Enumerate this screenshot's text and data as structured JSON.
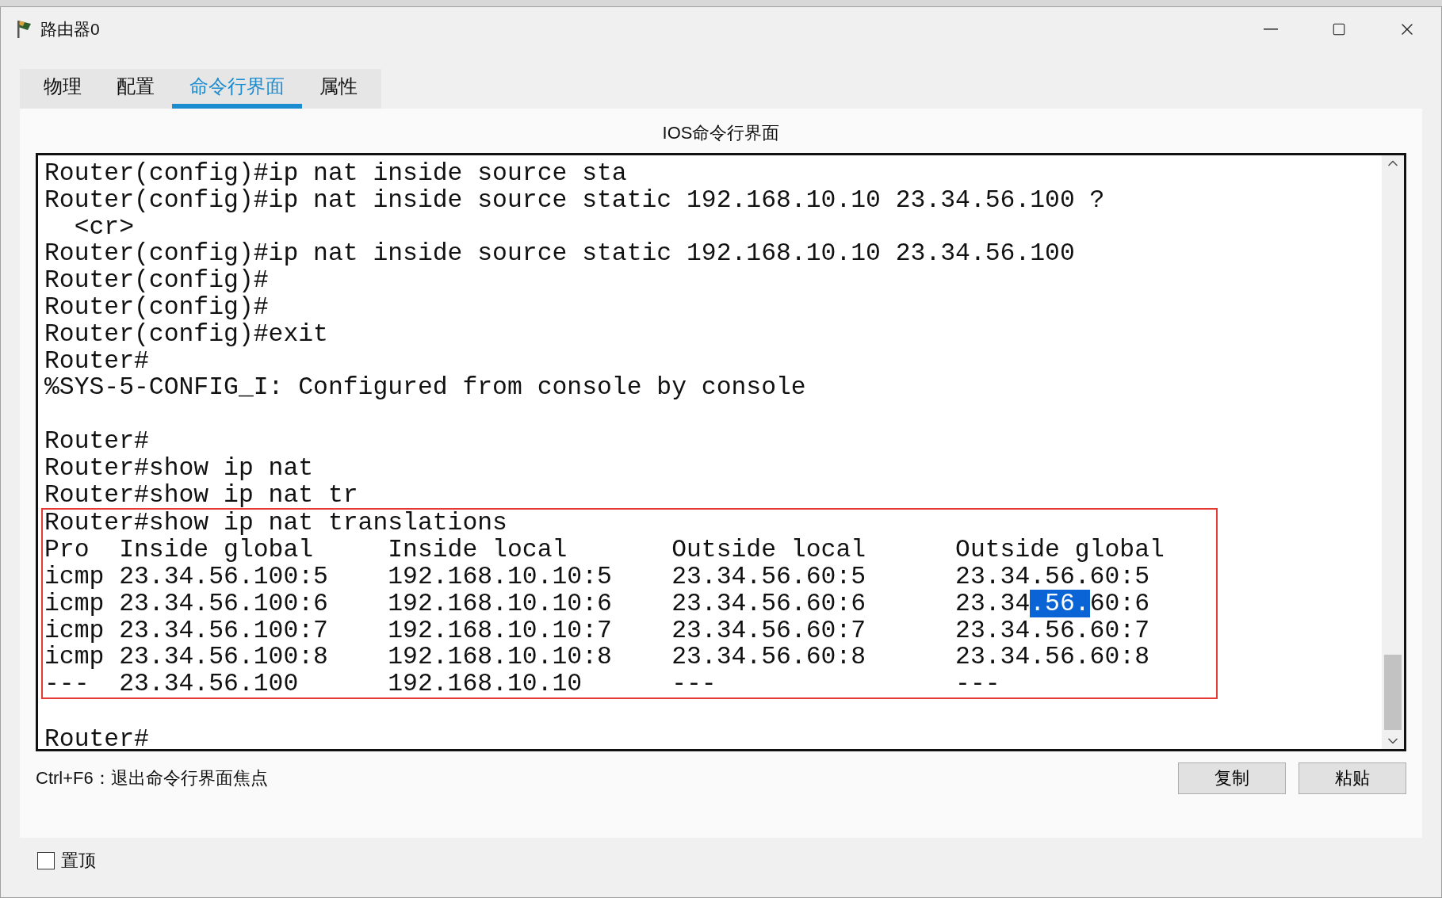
{
  "window": {
    "title": "路由器0"
  },
  "tabs": [
    {
      "label": "物理",
      "selected": false
    },
    {
      "label": "配置",
      "selected": false
    },
    {
      "label": "命令行界面",
      "selected": true
    },
    {
      "label": "属性",
      "selected": false
    }
  ],
  "panel_title": "IOS命令行界面",
  "terminal": {
    "lines_before": [
      {
        "kind": "text",
        "text": "Router(config)#ip nat inside source sta"
      },
      {
        "kind": "text",
        "text": "Router(config)#ip nat inside source static 192.168.10.10 23.34.56.100 ?"
      },
      {
        "kind": "text",
        "text": "  <cr>"
      },
      {
        "kind": "text",
        "text": "Router(config)#ip nat inside source static 192.168.10.10 23.34.56.100"
      },
      {
        "kind": "text",
        "text": "Router(config)#"
      },
      {
        "kind": "text",
        "text": "Router(config)#"
      },
      {
        "kind": "text",
        "text": "Router(config)#exit"
      },
      {
        "kind": "text",
        "text": "Router#"
      },
      {
        "kind": "text",
        "text": "%SYS-5-CONFIG_I: Configured from console by console"
      },
      {
        "kind": "blank"
      },
      {
        "kind": "text",
        "text": "Router#"
      },
      {
        "kind": "text",
        "text": "Router#show ip nat"
      },
      {
        "kind": "text",
        "text": "Router#show ip nat tr"
      }
    ],
    "highlighted_block": [
      {
        "segments": [
          {
            "text": "Router#show ip nat translations",
            "selected": false
          }
        ]
      },
      {
        "segments": [
          {
            "text": "Pro  Inside global     Inside local       Outside local      Outside global",
            "selected": false
          }
        ]
      },
      {
        "segments": [
          {
            "text": "icmp 23.34.56.100:5    192.168.10.10:5    23.34.56.60:5      23.34.56.60:5",
            "selected": false
          }
        ]
      },
      {
        "segments": [
          {
            "text": "icmp 23.34.56.100:6    192.168.10.10:6    23.34.56.60:6      23.34",
            "selected": false
          },
          {
            "text": ".56.",
            "selected": true
          },
          {
            "text": "60:6",
            "selected": false
          }
        ]
      },
      {
        "segments": [
          {
            "text": "icmp 23.34.56.100:7    192.168.10.10:7    23.34.56.60:7      23.34.56.60:7",
            "selected": false
          }
        ]
      },
      {
        "segments": [
          {
            "text": "icmp 23.34.56.100:8    192.168.10.10:8    23.34.56.60:8      23.34.56.60:8",
            "selected": false
          }
        ]
      },
      {
        "segments": [
          {
            "text": "---  23.34.56.100      192.168.10.10      ---                ---",
            "selected": false
          }
        ]
      }
    ],
    "lines_after": [
      {
        "kind": "blank"
      },
      {
        "kind": "text",
        "text": "Router#"
      }
    ]
  },
  "hint": "Ctrl+F6：退出命令行界面焦点",
  "buttons": [
    "复制",
    "粘贴"
  ],
  "stay_on_top": {
    "label": "置顶",
    "checked": false
  }
}
